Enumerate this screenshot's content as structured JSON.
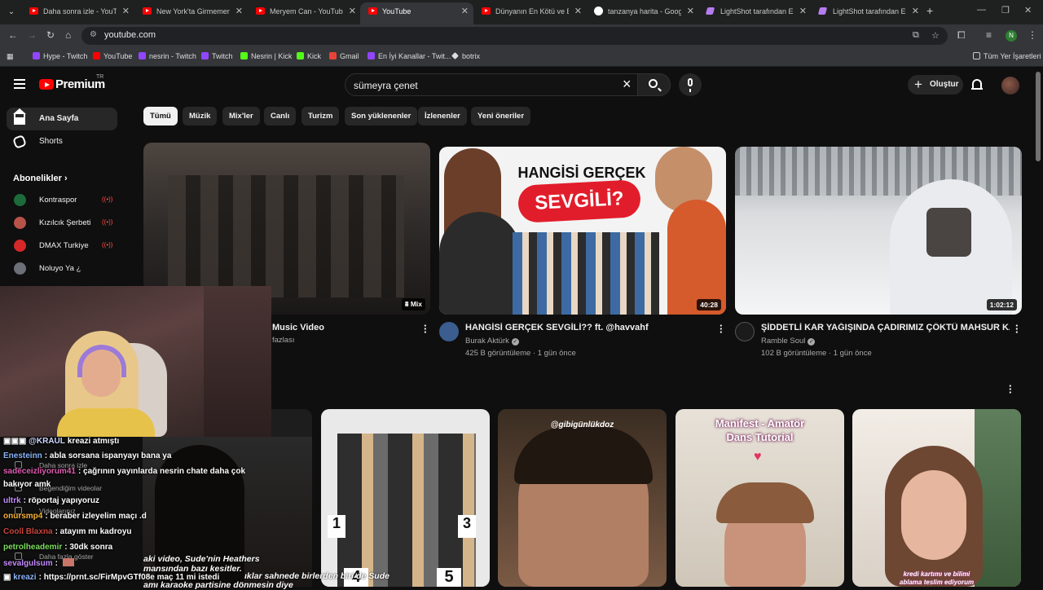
{
  "browser": {
    "tabs": [
      {
        "title": "Daha sonra izle - YouTube",
        "icon": "youtube-icon"
      },
      {
        "title": "New York'ta Girmemem Gereken",
        "icon": "youtube-icon"
      },
      {
        "title": "Meryem Can - YouTube",
        "icon": "youtube-icon"
      },
      {
        "title": "YouTube",
        "icon": "youtube-icon",
        "active": true
      },
      {
        "title": "Dünyanın En Kötü ve En P",
        "icon": "youtube-icon"
      },
      {
        "title": "tanzanya harita - Google",
        "icon": "google-icon"
      },
      {
        "title": "LightShot tarafından Ekran",
        "icon": "lightshot-icon"
      },
      {
        "title": "LightShot tarafından Ekran",
        "icon": "lightshot-icon"
      }
    ],
    "new_tab": "+",
    "url": "youtube.com",
    "profile_initial": "N",
    "bookmarks": [
      {
        "label": "Hype - Twitch",
        "icon": "twitch"
      },
      {
        "label": "YouTube",
        "icon": "youtube"
      },
      {
        "label": "nesrin - Twitch",
        "icon": "twitch"
      },
      {
        "label": "Twitch",
        "icon": "twitch"
      },
      {
        "label": "Nesrin | Kick",
        "icon": "kick"
      },
      {
        "label": "Kick",
        "icon": "kick"
      },
      {
        "label": "Gmail",
        "icon": "gmail"
      },
      {
        "label": "En İyi Kanallar - Twit...",
        "icon": "twitch"
      },
      {
        "label": "botrix",
        "icon": "botrix"
      }
    ],
    "all_bookmarks": "Tüm Yer İşaretleri"
  },
  "youtube": {
    "logo": "Premium",
    "logo_region": "TR",
    "search_query": "sümeyra çenet",
    "create_label": "Oluştur",
    "sidebar": {
      "home": "Ana Sayfa",
      "shorts": "Shorts",
      "subscriptions_header": "Abonelikler",
      "subscriptions": [
        {
          "name": "Kontraspor",
          "color": "#1d6b3a"
        },
        {
          "name": "Kızılcık Şerbeti",
          "color": "#b8534a"
        },
        {
          "name": "DMAX Turkiye",
          "color": "#d62828"
        },
        {
          "name": "Noluyo Ya ¿",
          "color": "#6c6f78"
        }
      ]
    },
    "chips": [
      "Tümü",
      "Müzik",
      "Mix'ler",
      "Canlı",
      "Turizm",
      "Son yüklenenler",
      "İzlenenler",
      "Yeni öneriler"
    ],
    "videos": [
      {
        "title_partial": "Music Video",
        "meta_partial": "fazlası",
        "badge": "Mix"
      },
      {
        "title": "HANGİSİ GERÇEK SEVGİLİ?? ft. @havvahf",
        "channel": "Burak Aktürk",
        "stats": "425 B görüntüleme · 1 gün önce",
        "duration": "40:28",
        "thumb_line1": "HANGİSİ GERÇEK",
        "thumb_line2": "SEVGİLİ?"
      },
      {
        "title": "ŞİDDETLİ KAR YAĞIŞINDA ÇADIRIMIZ ÇÖKTÜ MAHSUR KALDIK",
        "channel": "Ramble Soul",
        "stats": "102 B görüntüleme · 1 gün önce",
        "duration": "1:02:12"
      }
    ],
    "shorts": [
      {
        "overlay": ""
      },
      {
        "overlay": "",
        "numbers": [
          "1",
          "3",
          "4",
          "5"
        ]
      },
      {
        "overlay": "@gibigünlükdoz"
      },
      {
        "overlay_line1": "Manifest - Amatör",
        "overlay_line2": "Dans Tutorial"
      },
      {
        "overlay_line1": "kredi kartımı ve bilimi",
        "overlay_line2": "ablama teslim ediyorum"
      }
    ]
  },
  "stream_overlay": {
    "chat": [
      {
        "user": "@KRAUL",
        "text": "kreazi atmıştı",
        "color": "#cfd8ff"
      },
      {
        "user": "Enesteinn",
        "text": ": abla sorsana ispanyayı bana ya",
        "color": "#8ab4f8"
      },
      {
        "user": "sadeceizliyorum41",
        "text": ": çağrının yayınlarda nesrin chate daha çok",
        "color": "#e05cb0"
      },
      {
        "user": "",
        "text": "bakıyor amk",
        "color": "#fff"
      },
      {
        "user": "ultrk",
        "text": ": röportaj yapıyoruz",
        "color": "#c58cff"
      },
      {
        "user": "onursmp4",
        "text": ": beraber izleyelim maçı .d",
        "color": "#f5b23a"
      },
      {
        "user": "Cooll Blaxna",
        "text": ": atayım mı kadroyu",
        "color": "#c8453a"
      },
      {
        "user": "petrolheademir",
        "text": ": 30dk sonra",
        "color": "#7ddc5f"
      },
      {
        "user": "sevalgulsum",
        "text": ":",
        "color": "#c58cff"
      },
      {
        "user": "kreazi",
        "text": ": https://prnt.sc/FirMpvGTf08e maç 11 mi istedi",
        "color": "#8ab4f8"
      }
    ],
    "ghost_menu": [
      "Daha sonra izle",
      "Beğendiğim videolar",
      "Videolarınız",
      "Daha fazla göster"
    ],
    "caption_line1": "aki video, Sude'nin Heathers",
    "caption_line2": "mansından bazı kesitler.",
    "caption_line3": "ıklar sahnede birlerden biri de Sude",
    "caption_line4": "amı karaoke partisine dönmesin diye"
  }
}
